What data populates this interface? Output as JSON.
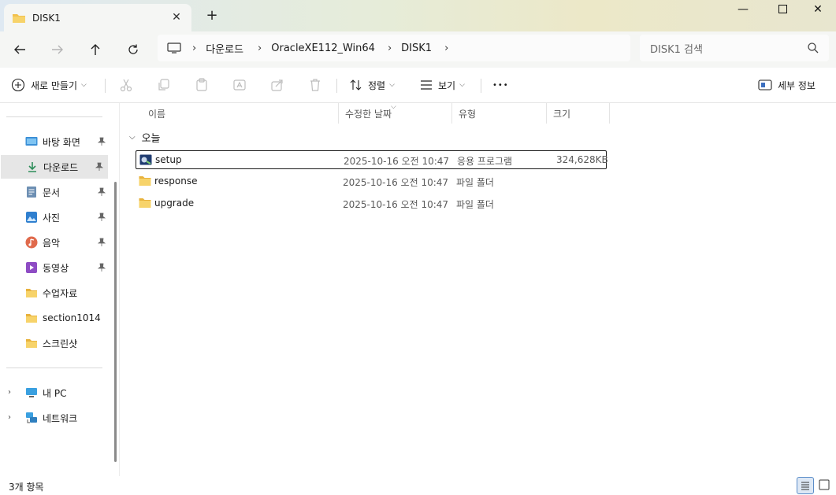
{
  "window": {
    "tab_title": "DISK1",
    "new_tab_icon": "plus-icon",
    "controls": [
      "minimize-icon",
      "maximize-icon",
      "close-icon"
    ]
  },
  "address": {
    "breadcrumbs": [
      "다운로드",
      "OracleXE112_Win64",
      "DISK1"
    ],
    "search_placeholder": "DISK1 검색"
  },
  "commandbar": {
    "new_label": "새로 만들기",
    "sort_label": "정렬",
    "view_label": "보기",
    "more_label": "•••",
    "details_label": "세부 정보"
  },
  "sidebar": {
    "quick_access": [
      {
        "label": "바탕 화면",
        "icon": "desktop-icon",
        "pinned": true
      },
      {
        "label": "다운로드",
        "icon": "download-icon",
        "pinned": true,
        "selected": true
      },
      {
        "label": "문서",
        "icon": "document-icon",
        "pinned": true
      },
      {
        "label": "사진",
        "icon": "picture-icon",
        "pinned": true
      },
      {
        "label": "음악",
        "icon": "music-icon",
        "pinned": true
      },
      {
        "label": "동영상",
        "icon": "video-icon",
        "pinned": true
      },
      {
        "label": "수업자료",
        "icon": "folder-icon",
        "pinned": false
      },
      {
        "label": "section1014",
        "icon": "folder-icon",
        "pinned": false
      },
      {
        "label": "스크린샷",
        "icon": "folder-icon",
        "pinned": false
      }
    ],
    "tree": [
      {
        "label": "내 PC",
        "icon": "pc-icon"
      },
      {
        "label": "네트워크",
        "icon": "network-icon"
      }
    ]
  },
  "list": {
    "columns": [
      "이름",
      "수정한 날짜",
      "유형",
      "크기"
    ],
    "group_label": "오늘",
    "rows": [
      {
        "name": "setup",
        "date": "2025-10-16 오전 10:47",
        "type": "응용 프로그램",
        "size": "324,628KB",
        "icon": "setup-app-icon"
      },
      {
        "name": "response",
        "date": "2025-10-16 오전 10:47",
        "type": "파일 폴더",
        "size": "",
        "icon": "folder-icon"
      },
      {
        "name": "upgrade",
        "date": "2025-10-16 오전 10:47",
        "type": "파일 폴더",
        "size": "",
        "icon": "folder-icon"
      }
    ]
  },
  "status": {
    "count_label": "3개 항목"
  }
}
